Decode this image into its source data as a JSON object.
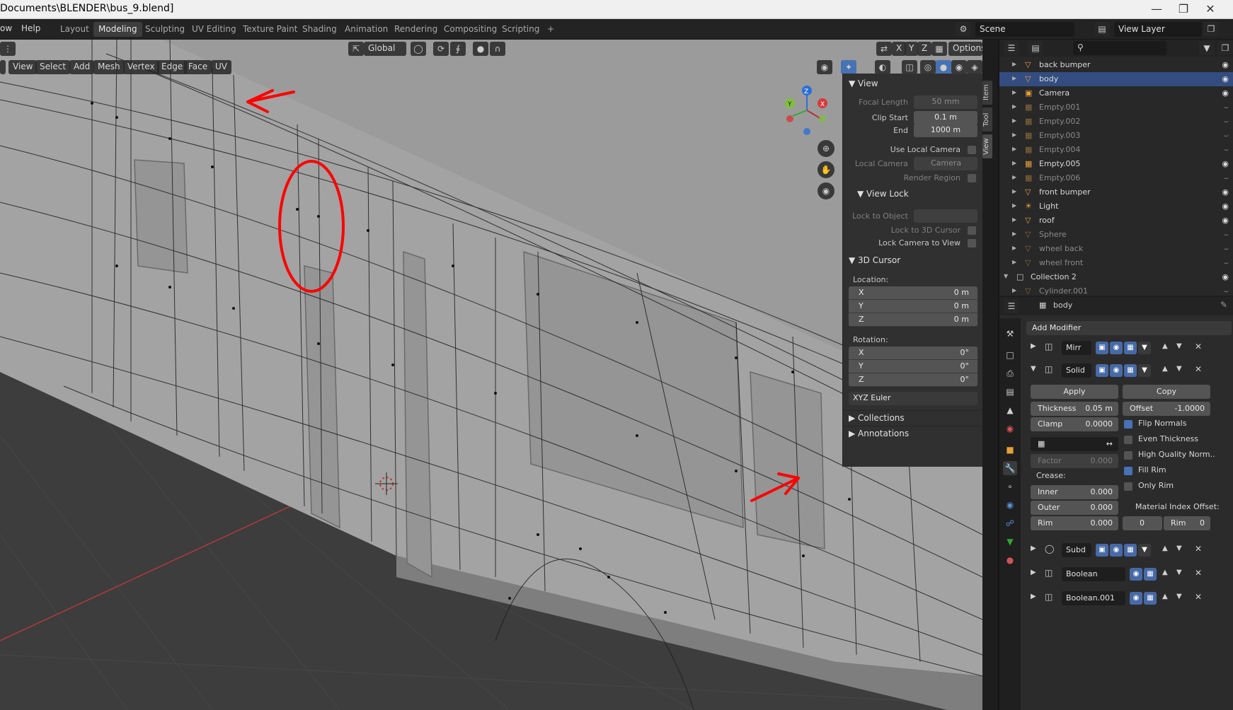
{
  "title_bar": {
    "title": "Documents\\BLENDER\\bus_9.blend]"
  },
  "menu": {
    "items": [
      "ow",
      "Help"
    ],
    "workspaces": [
      "Layout",
      "Modeling",
      "Sculpting",
      "UV Editing",
      "Texture Paint",
      "Shading",
      "Animation",
      "Rendering",
      "Compositing",
      "Scripting"
    ],
    "active_workspace": "Modeling",
    "add_tab": "+",
    "scene": "Scene",
    "view_layer": "View Layer"
  },
  "viewport_header": {
    "transform_orientation": "Global",
    "axes": [
      "X",
      "Y",
      "Z"
    ],
    "options": "Options",
    "menus": [
      "View",
      "Select",
      "Add",
      "Mesh",
      "Vertex",
      "Edge",
      "Face",
      "UV"
    ]
  },
  "gizmo": {
    "x": "X",
    "y": "Y",
    "z": "Z"
  },
  "side_tabs": [
    "Item",
    "Tool",
    "View"
  ],
  "n_panel": {
    "view_header": "View",
    "focal_length_label": "Focal Length",
    "focal_length": "50 mm",
    "clip_start_label": "Clip Start",
    "clip_start": "0.1 m",
    "clip_end_label": "End",
    "clip_end": "1000 m",
    "use_local_camera": "Use Local Camera",
    "local_camera_label": "Local Camera",
    "local_camera": "Camera",
    "render_region": "Render Region",
    "view_lock_header": "View Lock",
    "lock_to_object": "Lock to Object",
    "lock_to_cursor": "Lock to 3D Cursor",
    "lock_camera": "Lock Camera to View",
    "cursor_header": "3D Cursor",
    "location_label": "Location:",
    "location": [
      {
        "axis": "X",
        "value": "0 m"
      },
      {
        "axis": "Y",
        "value": "0 m"
      },
      {
        "axis": "Z",
        "value": "0 m"
      }
    ],
    "rotation_label": "Rotation:",
    "rotation": [
      {
        "axis": "X",
        "value": "0°"
      },
      {
        "axis": "Y",
        "value": "0°"
      },
      {
        "axis": "Z",
        "value": "0°"
      }
    ],
    "rotation_mode": "XYZ Euler",
    "collections_header": "Collections",
    "annotations_header": "Annotations"
  },
  "outliner": {
    "rows": [
      {
        "name": "back bumper",
        "kind": "mesh",
        "dim": false,
        "selected": false
      },
      {
        "name": "body",
        "kind": "mesh",
        "dim": false,
        "selected": true
      },
      {
        "name": "Camera",
        "kind": "camera",
        "dim": false,
        "selected": false
      },
      {
        "name": "Empty.001",
        "kind": "empty",
        "dim": true,
        "selected": false
      },
      {
        "name": "Empty.002",
        "kind": "empty",
        "dim": true,
        "selected": false
      },
      {
        "name": "Empty.003",
        "kind": "empty",
        "dim": true,
        "selected": false
      },
      {
        "name": "Empty.004",
        "kind": "empty",
        "dim": true,
        "selected": false
      },
      {
        "name": "Empty.005",
        "kind": "empty",
        "dim": false,
        "selected": false
      },
      {
        "name": "Empty.006",
        "kind": "empty",
        "dim": true,
        "selected": false
      },
      {
        "name": "front bumper",
        "kind": "mesh",
        "dim": false,
        "selected": false
      },
      {
        "name": "Light",
        "kind": "light",
        "dim": false,
        "selected": false
      },
      {
        "name": "roof",
        "kind": "mesh",
        "dim": false,
        "selected": false
      },
      {
        "name": "Sphere",
        "kind": "mesh",
        "dim": true,
        "selected": false
      },
      {
        "name": "wheel back",
        "kind": "mesh",
        "dim": true,
        "selected": false
      },
      {
        "name": "wheel front",
        "kind": "mesh",
        "dim": true,
        "selected": false
      },
      {
        "name": "Collection 2",
        "kind": "collection",
        "dim": false,
        "selected": false
      },
      {
        "name": "Cylinder.001",
        "kind": "mesh",
        "dim": true,
        "selected": false
      }
    ]
  },
  "properties": {
    "object_name": "body",
    "add_modifier": "Add Modifier",
    "modifiers": {
      "mirror": "Mirr",
      "solid": "Solid",
      "subd": "Subd",
      "boolean": "Boolean",
      "boolean2": "Boolean.001"
    },
    "apply": "Apply",
    "copy": "Copy",
    "thickness_label": "Thickness",
    "thickness": "0.05 m",
    "offset_label": "Offset",
    "offset": "-1.0000",
    "clamp_label": "Clamp",
    "clamp": "0.0000",
    "flip_normals": "Flip Normals",
    "even_thickness": "Even Thickness",
    "high_quality": "High Quality Norm..",
    "fill_rim": "Fill Rim",
    "only_rim": "Only Rim",
    "factor_label": "Factor",
    "factor": "0.000",
    "crease_label": "Crease:",
    "inner_label": "Inner",
    "inner": "0.000",
    "outer_label": "Outer",
    "outer": "0.000",
    "rim_label": "Rim",
    "rim": "0.000",
    "mat_offset_label": "Material Index Offset:",
    "mat_offset": "0",
    "mat_rim_label": "Rim",
    "mat_rim": "0"
  },
  "colors": {
    "accent": "#4772b3",
    "selection": "#334d80",
    "annotation": "#ff0000",
    "mesh_icon": "#e8a03a"
  }
}
